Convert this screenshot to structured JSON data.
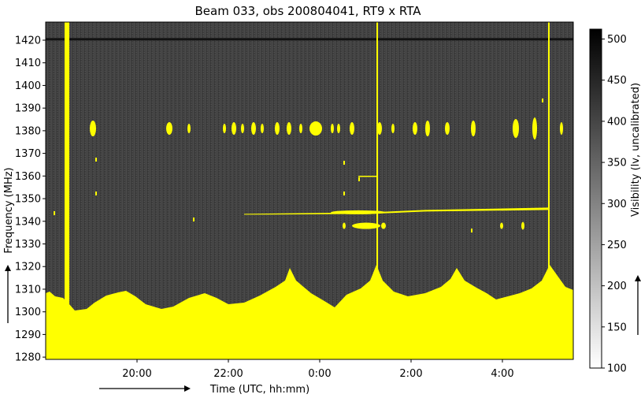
{
  "chart_data": {
    "type": "heatmap",
    "title": "Beam 033, obs 200804041, RT9 x RTA",
    "xlabel": "Time (UTC, hh:mm)",
    "ylabel": "Frequency (MHz)",
    "colorbar_label": "Visibility (lv, uncalibrated)",
    "x_ticks": [
      "20:00",
      "22:00",
      "0:00",
      "2:00",
      "4:00"
    ],
    "y_ticks": [
      1280,
      1290,
      1300,
      1310,
      1320,
      1330,
      1340,
      1350,
      1360,
      1370,
      1380,
      1390,
      1400,
      1410,
      1420
    ],
    "ylim": [
      1279,
      1428
    ],
    "colorbar_ticks": [
      100,
      150,
      200,
      250,
      300,
      350,
      400,
      450,
      500
    ],
    "colorbar_range": [
      100,
      512
    ],
    "colormap": "greys",
    "flag_color": "#ffff00",
    "background_level": 380,
    "hi_line_freq": 1420.4,
    "rfi_bands": [
      {
        "freq": 1381,
        "description": "intermittent bursts"
      },
      {
        "freq": 1345,
        "description": "drifting line"
      },
      {
        "freq": 1338,
        "description": "intermittent bursts"
      }
    ],
    "low_band_edge": {
      "description": "flagged below ~1305-1320 MHz throughout observation",
      "peaks_mhz": [
        1311,
        1310,
        1322,
        1322,
        1318,
        1322
      ]
    }
  }
}
